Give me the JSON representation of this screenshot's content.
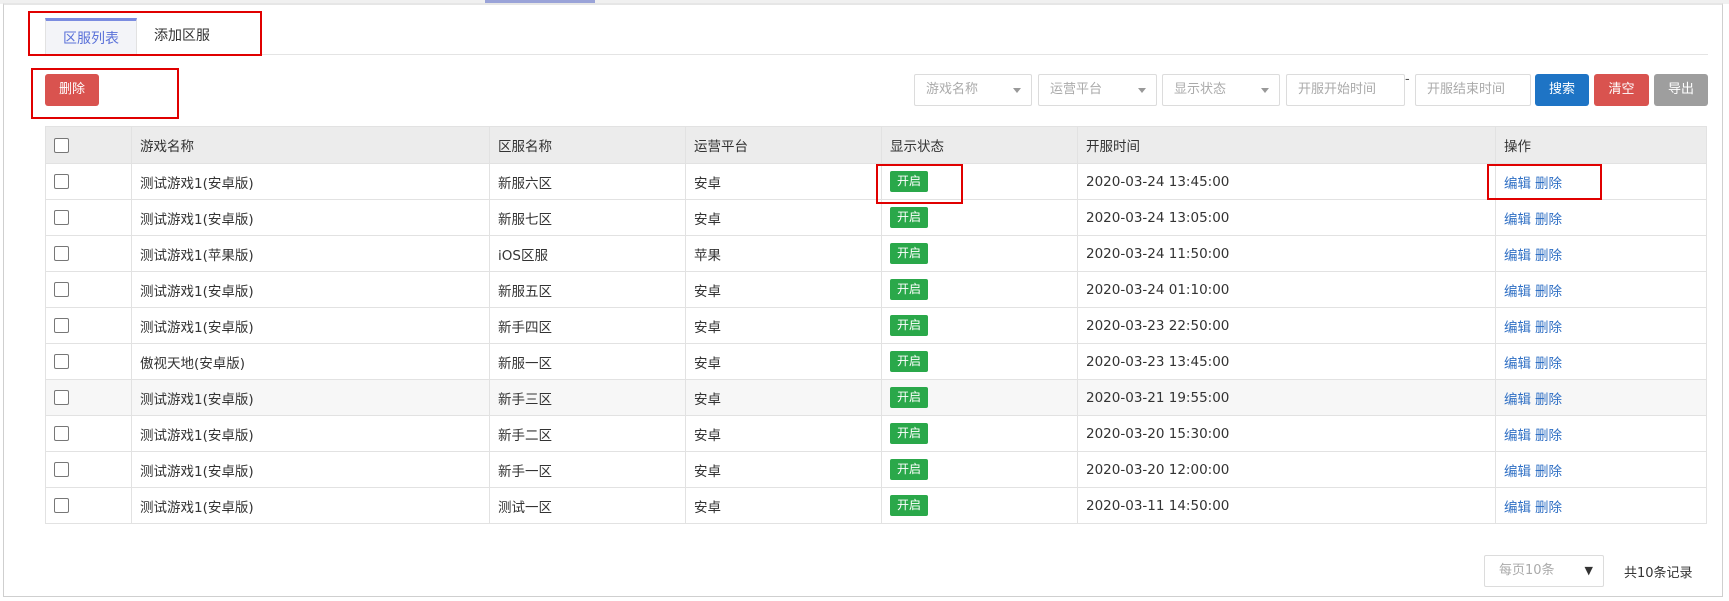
{
  "tabs": [
    {
      "label": "区服列表"
    },
    {
      "label": "添加区服"
    }
  ],
  "toolbar": {
    "delete_label": "删除",
    "game_name_placeholder": "游戏名称",
    "platform_placeholder": "运营平台",
    "status_placeholder": "显示状态",
    "start_time_placeholder": "开服开始时间",
    "range_separator": "-",
    "end_time_placeholder": "开服结束时间",
    "search_label": "搜索",
    "clear_label": "清空",
    "export_label": "导出"
  },
  "table": {
    "headers": [
      "游戏名称",
      "区服名称",
      "运营平台",
      "显示状态",
      "开服时间",
      "操作"
    ],
    "rows": [
      {
        "game": "测试游戏1(安卓版)",
        "server": "新服六区",
        "platform": "安卓",
        "status": "开启",
        "time": "2020-03-24 13:45:00"
      },
      {
        "game": "测试游戏1(安卓版)",
        "server": "新服七区",
        "platform": "安卓",
        "status": "开启",
        "time": "2020-03-24 13:05:00"
      },
      {
        "game": "测试游戏1(苹果版)",
        "server": "iOS区服",
        "platform": "苹果",
        "status": "开启",
        "time": "2020-03-24 11:50:00"
      },
      {
        "game": "测试游戏1(安卓版)",
        "server": "新服五区",
        "platform": "安卓",
        "status": "开启",
        "time": "2020-03-24 01:10:00"
      },
      {
        "game": "测试游戏1(安卓版)",
        "server": "新手四区",
        "platform": "安卓",
        "status": "开启",
        "time": "2020-03-23 22:50:00"
      },
      {
        "game": "傲视天地(安卓版)",
        "server": "新服一区",
        "platform": "安卓",
        "status": "开启",
        "time": "2020-03-23 13:45:00"
      },
      {
        "game": "测试游戏1(安卓版)",
        "server": "新手三区",
        "platform": "安卓",
        "status": "开启",
        "time": "2020-03-21 19:55:00"
      },
      {
        "game": "测试游戏1(安卓版)",
        "server": "新手二区",
        "platform": "安卓",
        "status": "开启",
        "time": "2020-03-20 15:30:00"
      },
      {
        "game": "测试游戏1(安卓版)",
        "server": "新手一区",
        "platform": "安卓",
        "status": "开启",
        "time": "2020-03-20 12:00:00"
      },
      {
        "game": "测试游戏1(安卓版)",
        "server": "测试一区",
        "platform": "安卓",
        "status": "开启",
        "time": "2020-03-11 14:50:00"
      }
    ],
    "edit_label": "编辑",
    "delete_label": "删除"
  },
  "footer": {
    "page_size": "每页10条",
    "page_size_arrow": "▼",
    "total": "共10条记录"
  },
  "colors": {
    "accent": "#5b72d9",
    "danger": "#d9534f",
    "primary": "#1e74c5",
    "success": "#2aa84a",
    "highlight": "#e00000"
  }
}
